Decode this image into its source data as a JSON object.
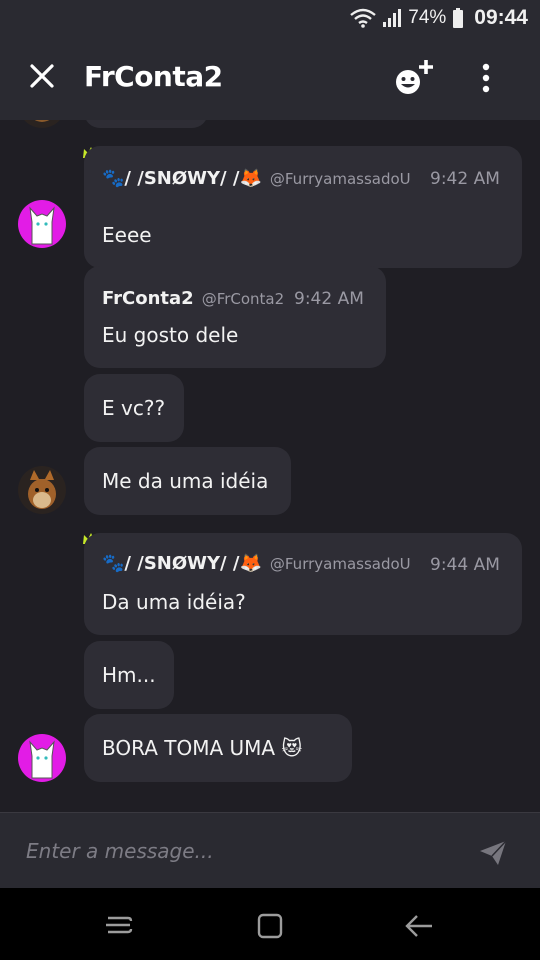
{
  "status_bar": {
    "battery": "74%",
    "time": "09:44"
  },
  "header": {
    "title": "FrConta2"
  },
  "messages": [
    {
      "author": "🐾/ /SNØWY/ /🦊",
      "handle": "@FurryamassadoU",
      "time": "9:42 AM",
      "text": "Eeee"
    },
    {
      "author": "FrConta2",
      "handle": "@FrConta2",
      "time": "9:42 AM",
      "text": "Eu gosto dele"
    },
    {
      "text": "E vc??"
    },
    {
      "text": "Me da uma idéia"
    },
    {
      "author": "🐾/ /SNØWY/ /🦊",
      "handle": "@FurryamassadoU",
      "time": "9:44 AM",
      "text": "Da uma idéia?"
    },
    {
      "text": "Hm..."
    },
    {
      "text": "BORA TOMA UMA 😻"
    }
  ],
  "composer": {
    "placeholder": "Enter a message..."
  },
  "icons": {
    "close": "close-icon",
    "add_emoji": "emoji-plus-icon",
    "menu": "kebab-menu-icon",
    "send": "send-icon",
    "crown": "crown-icon"
  },
  "colors": {
    "background": "#1f1e24",
    "bubble": "#2e2d35",
    "bar": "#2a2a31",
    "avatar_pink": "#e21ce6",
    "crown": "#c6e829"
  }
}
